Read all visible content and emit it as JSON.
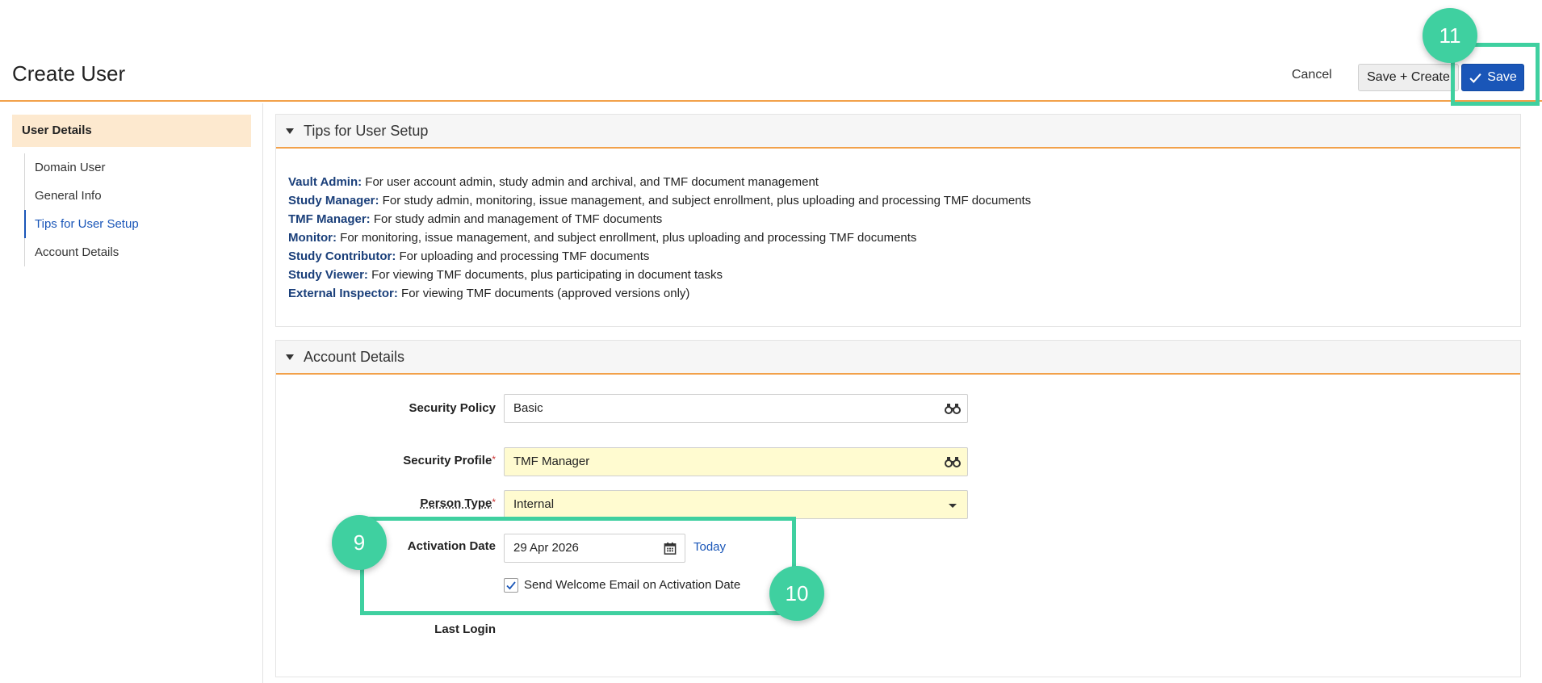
{
  "header": {
    "title": "Create User",
    "cancel_label": "Cancel",
    "save_create_label": "Save + Create",
    "save_label": "Save"
  },
  "sidebar": {
    "heading": "User Details",
    "items": [
      {
        "label": "Domain User"
      },
      {
        "label": "General Info"
      },
      {
        "label": "Tips for User Setup"
      },
      {
        "label": "Account Details"
      }
    ]
  },
  "tips": {
    "title": "Tips for User Setup",
    "items": [
      {
        "role": "Vault Admin:",
        "text": " For user account admin, study admin and archival, and TMF document management"
      },
      {
        "role": "Study Manager:",
        "text": " For study admin, monitoring, issue management, and subject enrollment, plus uploading and processing TMF documents"
      },
      {
        "role": "TMF Manager:",
        "text": " For study admin and management of TMF documents"
      },
      {
        "role": "Monitor:",
        "text": " For monitoring, issue management, and subject enrollment, plus uploading and processing TMF documents"
      },
      {
        "role": "Study Contributor:",
        "text": " For uploading and processing TMF documents"
      },
      {
        "role": "Study Viewer:",
        "text": " For viewing TMF documents, plus participating in document tasks"
      },
      {
        "role": "External Inspector:",
        "text": " For viewing TMF documents (approved versions only)"
      }
    ]
  },
  "account": {
    "title": "Account Details",
    "security_policy": {
      "label": "Security Policy",
      "value": "Basic"
    },
    "security_profile": {
      "label": "Security Profile",
      "required": "*",
      "value": "TMF Manager"
    },
    "person_type": {
      "label": "Person Type",
      "required": "*",
      "value": "Internal"
    },
    "activation_date": {
      "label": "Activation Date",
      "value": "29 Apr 2026",
      "today_label": "Today"
    },
    "welcome_email": {
      "label": "Send Welcome Email on Activation Date",
      "checked": true
    },
    "last_login": {
      "label": "Last Login"
    }
  },
  "annotations": {
    "badge_9": "9",
    "badge_10": "10",
    "badge_11": "11",
    "color": "#3fd0a0"
  },
  "colors": {
    "accent_orange": "#f2a14a",
    "primary_blue": "#1a56b8",
    "required_field": "#fffbd0",
    "sidebar_active_bg": "#fde9cf"
  },
  "icons": {
    "lookup": "binoculars-icon",
    "date": "calendar-icon",
    "dropdown": "chevron-down-icon",
    "save": "check-icon",
    "collapse": "caret-down-icon"
  }
}
